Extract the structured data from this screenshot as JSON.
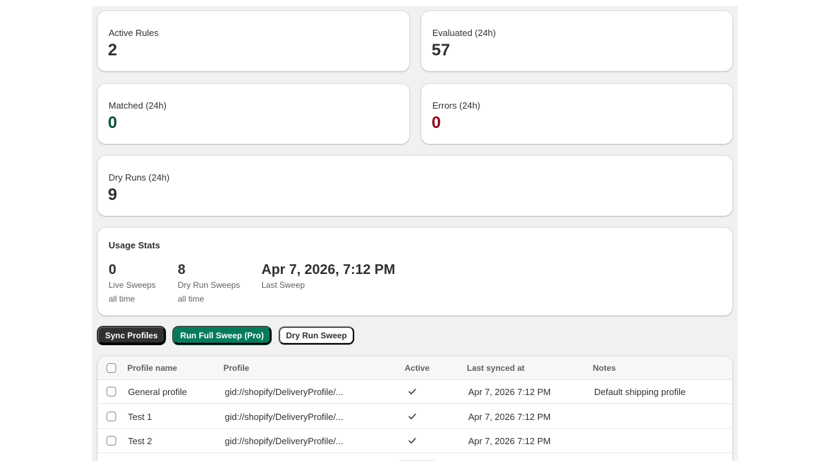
{
  "metrics": {
    "active_rules": {
      "label": "Active Rules",
      "value": "2"
    },
    "evaluated": {
      "label": "Evaluated (24h)",
      "value": "57"
    },
    "matched": {
      "label": "Matched (24h)",
      "value": "0"
    },
    "errors": {
      "label": "Errors (24h)",
      "value": "0"
    },
    "dry_runs": {
      "label": "Dry Runs (24h)",
      "value": "9"
    }
  },
  "colors": {
    "matched_value": "#0c5132",
    "errors_value": "#8e0b21",
    "primary_button": "#047b5d"
  },
  "usage": {
    "title": "Usage Stats",
    "stats": [
      {
        "value": "0",
        "label": "Live Sweeps",
        "sub": "all time"
      },
      {
        "value": "8",
        "label": "Dry Run Sweeps",
        "sub": "all time"
      },
      {
        "value": "Apr 7, 2026, 7:12 PM",
        "label": "Last Sweep",
        "sub": ""
      }
    ]
  },
  "actions": {
    "sync_profiles": "Sync Profiles",
    "run_full_sweep": "Run Full Sweep (Pro)",
    "dry_run_sweep": "Dry Run Sweep"
  },
  "table": {
    "headers": [
      "Profile name",
      "Profile",
      "Active",
      "Last synced at",
      "Notes"
    ],
    "rows": [
      {
        "name": "General profile",
        "profile": "gid://shopify/DeliveryProfile/...",
        "active": true,
        "last_synced": "Apr 7, 2026 7:12 PM",
        "notes": "Default shipping profile"
      },
      {
        "name": "Test 1",
        "profile": "gid://shopify/DeliveryProfile/...",
        "active": true,
        "last_synced": "Apr 7, 2026 7:12 PM",
        "notes": ""
      },
      {
        "name": "Test 2",
        "profile": "gid://shopify/DeliveryProfile/...",
        "active": true,
        "last_synced": "Apr 7, 2026 7:12 PM",
        "notes": ""
      }
    ]
  }
}
